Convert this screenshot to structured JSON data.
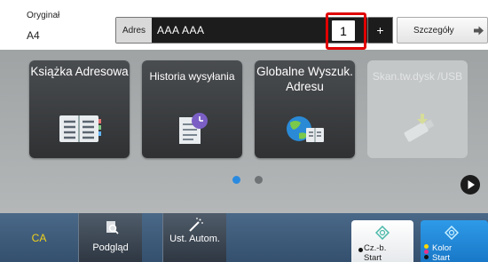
{
  "header": {
    "original_label": "Oryginał",
    "original_value": "A4",
    "address_key": "Adres",
    "address_value": "AAA   AAA",
    "address_count": "1",
    "plus_label": "+",
    "details_label": "Szczegóły"
  },
  "tiles": [
    {
      "label": "Książka Adresowa",
      "icon": "address-book-icon"
    },
    {
      "label": "Historia wysyłania",
      "icon": "sending-history-icon"
    },
    {
      "label": "Globalne Wyszuk. Adresu",
      "icon": "global-address-search-icon"
    },
    {
      "label": "Skan.tw.dysk /USB",
      "icon": "usb-drive-icon",
      "disabled": true
    }
  ],
  "pager": {
    "pages": 2,
    "current": 1
  },
  "footer": {
    "ca_label": "CA",
    "preview_label": "Podgląd",
    "auto_set_label": "Ust. Autom.",
    "bw_start_label_1": "Cz.-b.",
    "bw_start_label_2": "Start",
    "color_start_label_1": "Kolor",
    "color_start_label_2": "Start"
  },
  "colors": {
    "ca_text": "#f2d21a",
    "highlight": "#e00000",
    "color_start": "#1e8cdc",
    "active_page_dot": "#2a8ae0"
  }
}
